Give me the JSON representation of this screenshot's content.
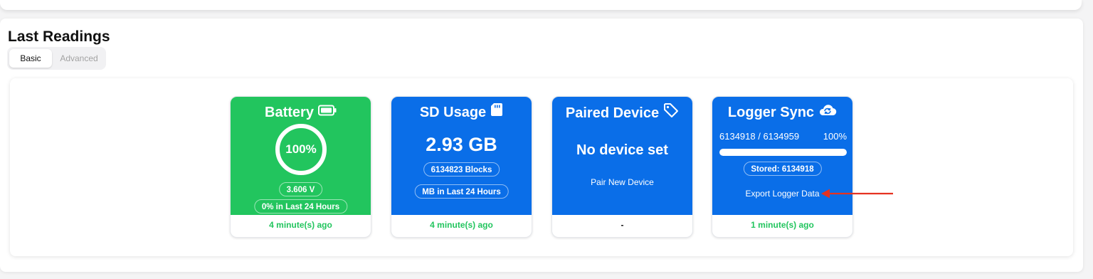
{
  "section": {
    "title": "Last Readings"
  },
  "tabs": [
    {
      "label": "Basic",
      "active": true
    },
    {
      "label": "Advanced",
      "active": false
    }
  ],
  "colors": {
    "green": "#22c55e",
    "blue": "#0a6ee8"
  },
  "cards": {
    "battery": {
      "title": "Battery",
      "icon": "battery-icon",
      "percent_label": "100%",
      "percent": 100,
      "voltage": "3.606 V",
      "change": "0% in Last 24 Hours",
      "updated": "4 minute(s) ago"
    },
    "sd": {
      "title": "SD Usage",
      "icon": "sd-card-icon",
      "usage": "2.93 GB",
      "blocks": "6134823 Blocks",
      "daily": "MB in Last 24 Hours",
      "updated": "4 minute(s) ago"
    },
    "paired": {
      "title": "Paired Device",
      "icon": "tag-icon",
      "status": "No device set",
      "action": "Pair New Device",
      "updated": "-"
    },
    "sync": {
      "title": "Logger Sync",
      "icon": "cloud-sync-icon",
      "counts": "6134918 / 6134959",
      "percent_label": "100%",
      "progress": 1.0,
      "stored": "Stored: 6134918",
      "action": "Export Logger Data",
      "updated": "1 minute(s) ago"
    }
  }
}
